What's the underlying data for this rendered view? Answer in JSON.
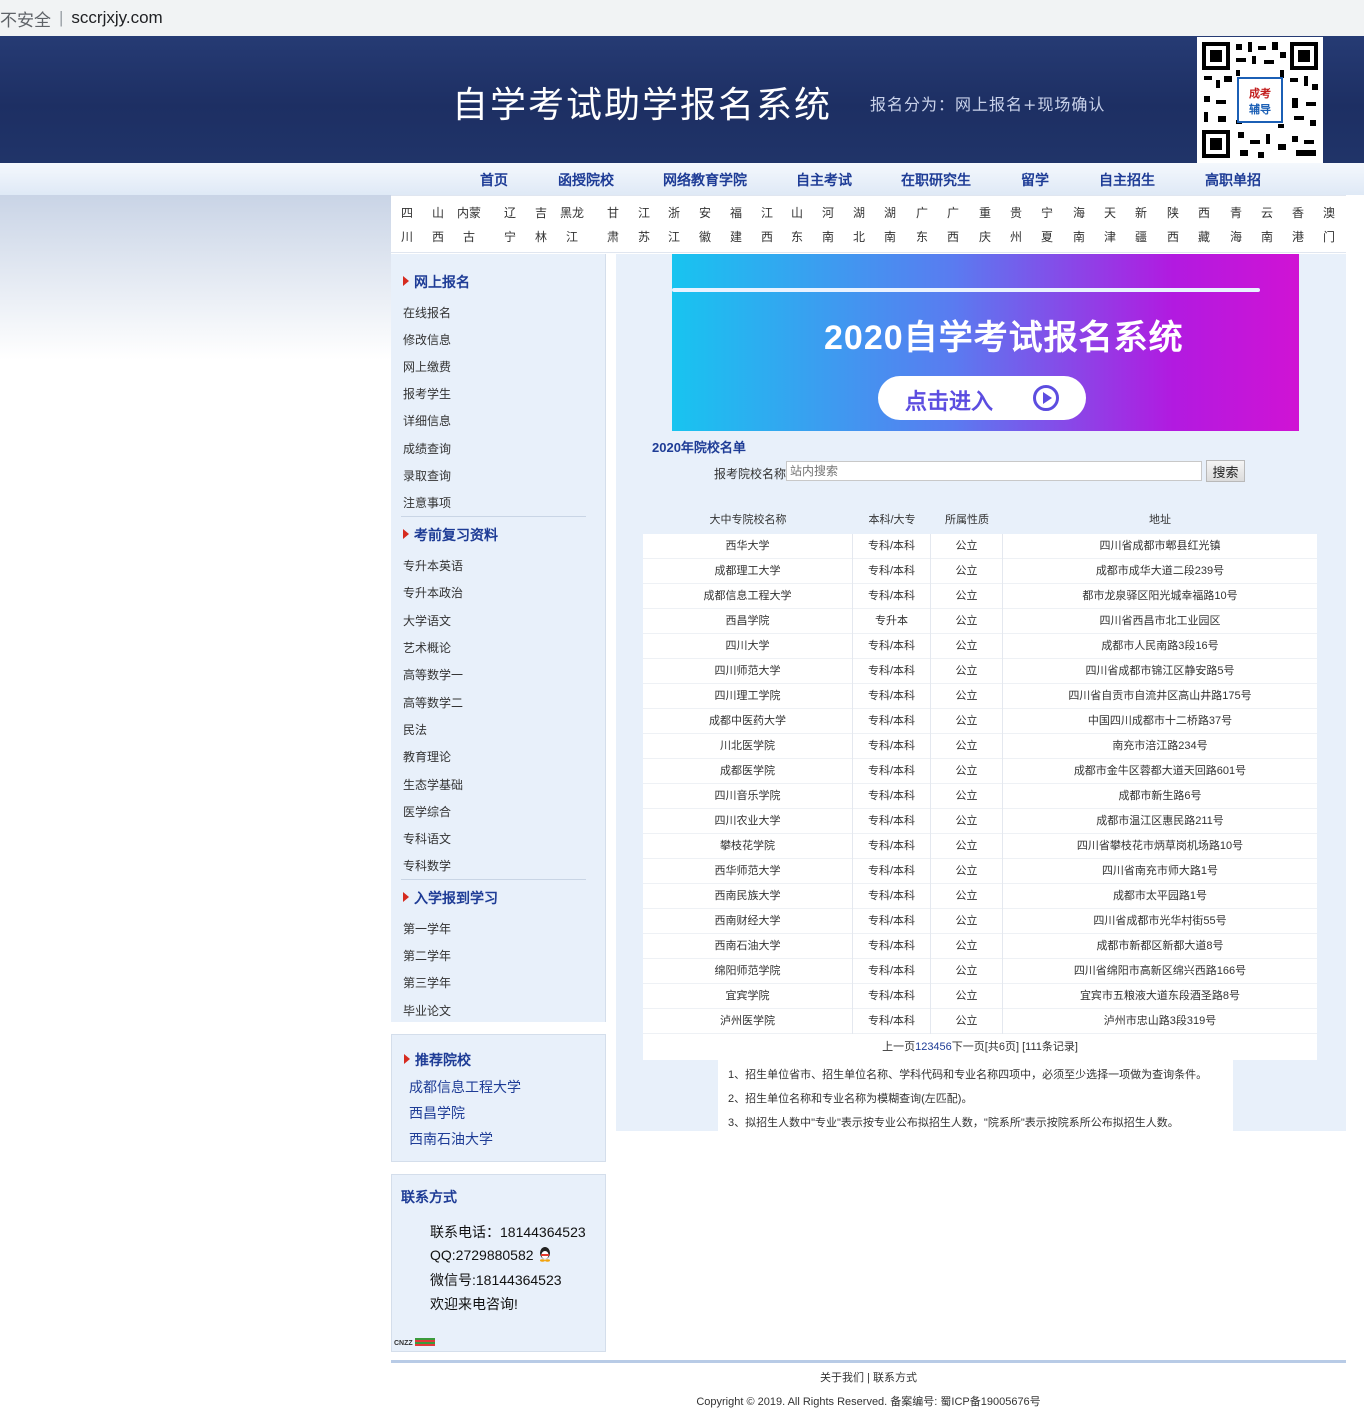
{
  "browser": {
    "security_label": "不安全",
    "url": "sccrjxjy.com"
  },
  "header": {
    "title": "自学考试助学报名系统",
    "subtitle": "报名分为：网上报名+现场确认",
    "qr_text": "成考辅导"
  },
  "nav": [
    "首页",
    "函授院校",
    "网络教育学院",
    "自主考试",
    "在职研究生",
    "留学",
    "自主招生",
    "高职单招"
  ],
  "provinces": [
    [
      "四",
      "川"
    ],
    [
      "山",
      "西"
    ],
    [
      "内蒙",
      "古"
    ],
    [
      "辽",
      "宁"
    ],
    [
      "吉",
      "林"
    ],
    [
      "黑龙",
      "江"
    ],
    [
      "甘",
      "肃"
    ],
    [
      "江",
      "苏"
    ],
    [
      "浙",
      "江"
    ],
    [
      "安",
      "徽"
    ],
    [
      "福",
      "建"
    ],
    [
      "江",
      "西"
    ],
    [
      "山",
      "东"
    ],
    [
      "河",
      "南"
    ],
    [
      "湖",
      "北"
    ],
    [
      "湖",
      "南"
    ],
    [
      "广",
      "东"
    ],
    [
      "广",
      "西"
    ],
    [
      "重",
      "庆"
    ],
    [
      "贵",
      "州"
    ],
    [
      "宁",
      "夏"
    ],
    [
      "海",
      "南"
    ],
    [
      "天",
      "津"
    ],
    [
      "新",
      "疆"
    ],
    [
      "陕",
      "西"
    ],
    [
      "西",
      "藏"
    ],
    [
      "青",
      "海"
    ],
    [
      "云",
      "南"
    ],
    [
      "香",
      "港"
    ],
    [
      "澳",
      "门"
    ]
  ],
  "sidebar": {
    "sections": [
      {
        "title": "网上报名",
        "items": [
          "在线报名",
          "修改信息",
          "网上缴费",
          "报考学生",
          "详细信息",
          "成绩查询",
          "录取查询",
          "注意事项"
        ]
      },
      {
        "title": "考前复习资料",
        "items": [
          "专升本英语",
          "专升本政治",
          "大学语文",
          "艺术概论",
          "高等数学一",
          "高等数学二",
          "民法",
          "教育理论",
          "生态学基础",
          "医学综合",
          "专科语文",
          "专科数学"
        ]
      },
      {
        "title": "入学报到学习",
        "items": [
          "第一学年",
          "第二学年",
          "第三学年",
          "毕业论文"
        ]
      }
    ],
    "recommend": {
      "title": "推荐院校",
      "links": [
        "成都信息工程大学",
        "西昌学院",
        "西南石油大学"
      ]
    },
    "contact": {
      "title": "联系方式",
      "phone": "联系电话：18144364523",
      "qq": "QQ:2729880582",
      "wechat": "微信号:18144364523",
      "welcome": "欢迎来电咨询!"
    },
    "cnzz": "CNZZ"
  },
  "main": {
    "banner": {
      "title": "2020自学考试报名系统",
      "button": "点击进入"
    },
    "list_title": "2020年院校名单",
    "search": {
      "label": "报考院校名称",
      "placeholder": "站内搜索",
      "button": "搜索"
    },
    "table": {
      "headers": [
        "大中专院校名称",
        "本科/大专",
        "所属性质",
        "地址"
      ],
      "rows": [
        [
          "西华大学",
          "专科/本科",
          "公立",
          "四川省成都市郫县红光镇"
        ],
        [
          "成都理工大学",
          "专科/本科",
          "公立",
          "成都市成华大道二段239号"
        ],
        [
          "成都信息工程大学",
          "专科/本科",
          "公立",
          "都市龙泉驿区阳光城幸福路10号"
        ],
        [
          "西昌学院",
          "专升本",
          "公立",
          "四川省西昌市北工业园区"
        ],
        [
          "四川大学",
          "专科/本科",
          "公立",
          "成都市人民南路3段16号"
        ],
        [
          "四川师范大学",
          "专科/本科",
          "公立",
          "四川省成都市锦江区静安路5号"
        ],
        [
          "四川理工学院",
          "专科/本科",
          "公立",
          "四川省自贡市自流井区高山井路175号"
        ],
        [
          "成都中医药大学",
          "专科/本科",
          "公立",
          "中国四川成都市十二桥路37号"
        ],
        [
          "川北医学院",
          "专科/本科",
          "公立",
          "南充市涪江路234号"
        ],
        [
          "成都医学院",
          "专科/本科",
          "公立",
          "成都市金牛区蓉都大道天回路601号"
        ],
        [
          "四川音乐学院",
          "专科/本科",
          "公立",
          "成都市新生路6号"
        ],
        [
          "四川农业大学",
          "专科/本科",
          "公立",
          "成都市温江区惠民路211号"
        ],
        [
          "攀枝花学院",
          "专科/本科",
          "公立",
          "四川省攀枝花市炳草岗机场路10号"
        ],
        [
          "西华师范大学",
          "专科/本科",
          "公立",
          "四川省南充市师大路1号"
        ],
        [
          "西南民族大学",
          "专科/本科",
          "公立",
          "成都市太平园路1号"
        ],
        [
          "西南财经大学",
          "专科/本科",
          "公立",
          "四川省成都市光华村街55号"
        ],
        [
          "西南石油大学",
          "专科/本科",
          "公立",
          "成都市新都区新都大道8号"
        ],
        [
          "绵阳师范学院",
          "专科/本科",
          "公立",
          "四川省绵阳市高新区绵兴西路166号"
        ],
        [
          "宜宾学院",
          "专科/本科",
          "公立",
          "宜宾市五粮液大道东段酒圣路8号"
        ],
        [
          "泸州医学院",
          "专科/本科",
          "公立",
          "泸州市忠山路3段319号"
        ]
      ]
    },
    "pager": {
      "prev": "上一页",
      "pages": "123456",
      "next": "下一页",
      "info": "[共6页] [111条记录]"
    },
    "notes": [
      "1、招生单位省市、招生单位名称、学科代码和专业名称四项中，必须至少选择一项做为查询条件。",
      "2、招生单位名称和专业名称为模糊查询(左匹配)。",
      "3、拟招生人数中\"专业\"表示按专业公布拟招生人数，\"院系所\"表示按院系所公布拟招生人数。"
    ]
  },
  "footer": {
    "links": "关于我们 | 联系方式",
    "copyright": "Copyright © 2019. All Rights Reserved. 备案编号: 蜀ICP备19005676号"
  }
}
